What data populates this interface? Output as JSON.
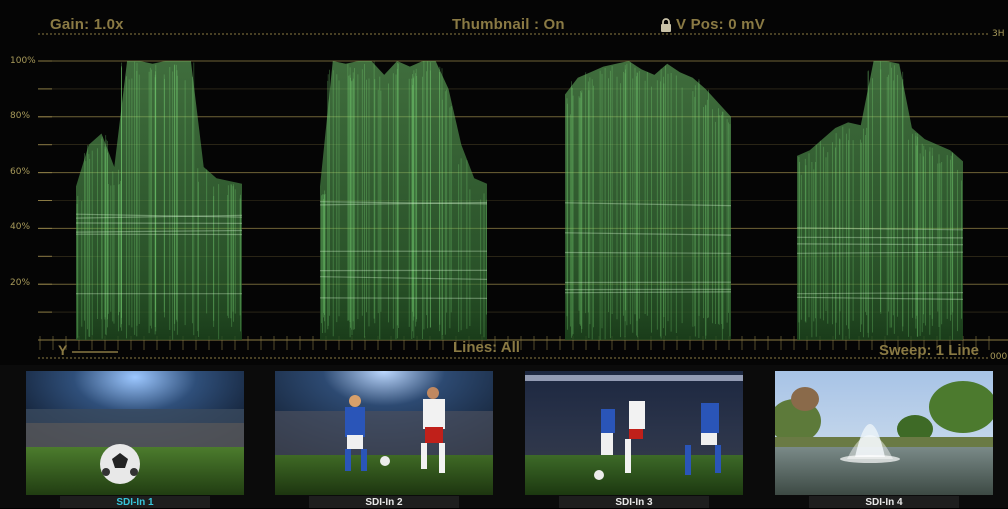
{
  "header": {
    "gain": "Gain: 1.0x",
    "thumbnail": "Thumbnail : On",
    "vpos": "V Pos: 0 mV",
    "lock_icon": "lock-icon"
  },
  "scale": {
    "labels": [
      "100%",
      "80%",
      "60%",
      "40%",
      "20%"
    ],
    "right_top": "3H",
    "right_bottom": "000"
  },
  "footer": {
    "channel": "Y",
    "lines": "Lines: All",
    "sweep": "Sweep: 1 Line"
  },
  "inputs": [
    {
      "label": "SDI-In 1",
      "active": true
    },
    {
      "label": "SDI-In 2",
      "active": false
    },
    {
      "label": "SDI-In 3",
      "active": false
    },
    {
      "label": "SDI-In 4",
      "active": false
    }
  ],
  "colors": {
    "trace": "#7fe07a",
    "graticule": "#8a7a44",
    "active_input": "#37c6dc"
  }
}
